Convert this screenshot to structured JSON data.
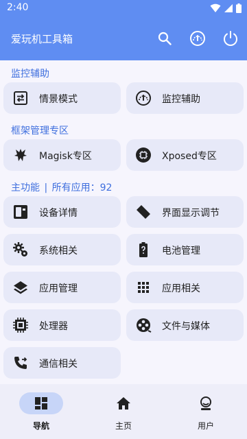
{
  "status": {
    "time": "2:40"
  },
  "app": {
    "title": "爱玩机工具箱"
  },
  "sections": {
    "monitor": "监控辅助",
    "framework": "框架管理专区",
    "main_prefix": "主功能",
    "main_divider": "|",
    "main_apps_label": "所有应用：",
    "main_apps_count": "92"
  },
  "cards": {
    "scene_mode": "情景模式",
    "monitor_aid": "监控辅助",
    "magisk": "Magisk专区",
    "xposed": "Xposed专区",
    "device_info": "设备详情",
    "display_adjust": "界面显示调节",
    "system": "系统相关",
    "battery": "电池管理",
    "app_manage": "应用管理",
    "app_related": "应用相关",
    "processor": "处理器",
    "files_media": "文件与媒体",
    "telecom": "通信相关"
  },
  "nav": {
    "items": [
      {
        "label": "导航",
        "icon": "dashboard-icon",
        "active": true
      },
      {
        "label": "主页",
        "icon": "home-icon",
        "active": false
      },
      {
        "label": "用户",
        "icon": "user-icon",
        "active": false
      }
    ]
  },
  "colors": {
    "primary": "#5f8df2",
    "section_title": "#3f6fde",
    "card_bg": "#e7e9f8",
    "page_bg": "#f6f5fd",
    "nav_active_pill": "#c7d5f8"
  }
}
